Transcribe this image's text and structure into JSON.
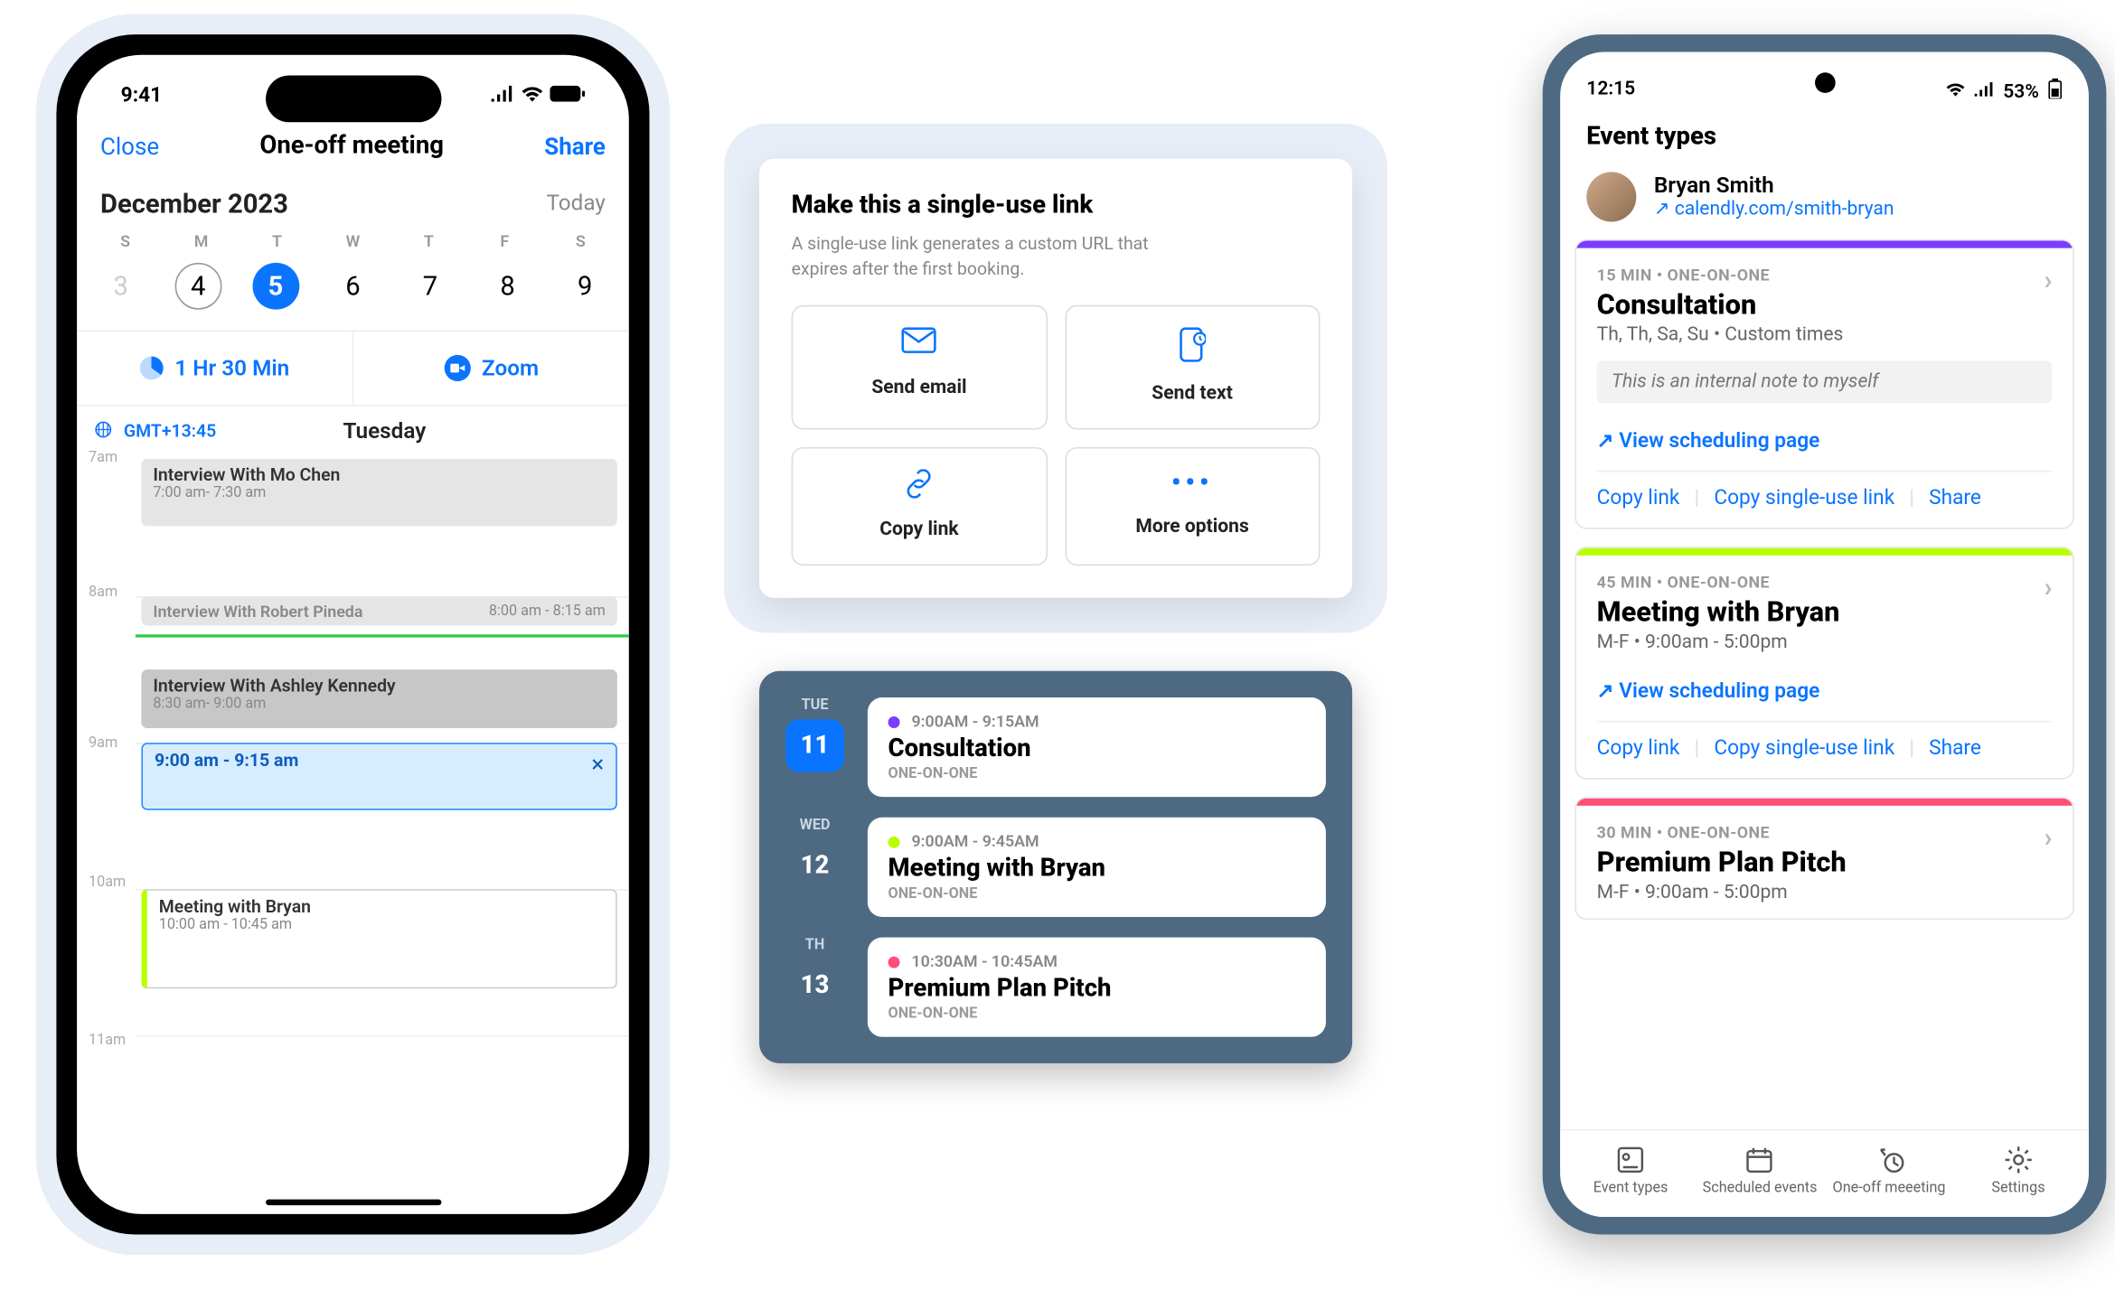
{
  "phone1": {
    "status": {
      "time": "9:41",
      "signal": "•ıll",
      "wifi": "wifi",
      "battery": "batt"
    },
    "nav": {
      "close": "Close",
      "title": "One-off meeting",
      "share": "Share"
    },
    "month_label": "December 2023",
    "today_label": "Today",
    "dow": [
      "S",
      "M",
      "T",
      "W",
      "T",
      "F",
      "S"
    ],
    "days": [
      "3",
      "4",
      "5",
      "6",
      "7",
      "8",
      "9"
    ],
    "duration": "1 Hr 30 Min",
    "location": "Zoom",
    "tz": "GMT+13:45",
    "day_title": "Tuesday",
    "hours": {
      "h7": "7am",
      "h8": "8am",
      "h9": "9am",
      "h10": "10am",
      "h11": "11am"
    },
    "events": {
      "e1": {
        "title": "Interview With Mo Chen",
        "sub": "7:00 am- 7:30 am"
      },
      "e2": {
        "title": "Interview With Robert Pineda",
        "sub": "8:00 am - 8:15 am"
      },
      "e3": {
        "title": "Interview With Ashley Kennedy",
        "sub": "8:30 am- 9:00 am"
      },
      "e4": {
        "title": "9:00 am - 9:15 am",
        "close": "×"
      },
      "e5": {
        "title": "Meeting with Bryan",
        "sub": "10:00 am - 10:45 am"
      }
    }
  },
  "card1": {
    "heading": "Make this a single-use link",
    "sub": "A single-use link generates a custom URL that expires after the first booking.",
    "opts": {
      "email": "Send email",
      "text": "Send text",
      "copy": "Copy link",
      "more": "More options"
    }
  },
  "card2": {
    "rows": [
      {
        "dow": "TUE",
        "num": "11",
        "time": "9:00AM - 9:15AM",
        "name": "Consultation",
        "type": "ONE-ON-ONE"
      },
      {
        "dow": "WED",
        "num": "12",
        "time": "9:00AM - 9:45AM",
        "name": "Meeting with Bryan",
        "type": "ONE-ON-ONE"
      },
      {
        "dow": "TH",
        "num": "13",
        "time": "10:30AM - 10:45AM",
        "name": "Premium Plan Pitch",
        "type": "ONE-ON-ONE"
      }
    ]
  },
  "phone2": {
    "status": {
      "time": "12:15",
      "batt": "53%"
    },
    "page_title": "Event types",
    "user": {
      "name": "Bryan Smith",
      "url": "calendly.com/smith-bryan"
    },
    "et": [
      {
        "bar": "purple",
        "meta": "15 MIN • ONE-ON-ONE",
        "title": "Consultation",
        "times": "Th, Th, Sa, Su • Custom times",
        "note": "This is an internal note to myself",
        "view": "View scheduling page",
        "actions": {
          "a": "Copy link",
          "b": "Copy single-use link",
          "c": "Share"
        }
      },
      {
        "bar": "green",
        "meta": "45 MIN • ONE-ON-ONE",
        "title": "Meeting with Bryan",
        "times": "M-F • 9:00am - 5:00pm",
        "view": "View scheduling page",
        "actions": {
          "a": "Copy link",
          "b": "Copy single-use link",
          "c": "Share"
        }
      },
      {
        "bar": "pink",
        "meta": "30 MIN • ONE-ON-ONE",
        "title": "Premium Plan Pitch",
        "times": "M-F • 9:00am - 5:00pm"
      }
    ],
    "nav": {
      "a": "Event types",
      "b": "Scheduled events",
      "c": "One-off meeeting",
      "d": "Settings"
    }
  }
}
